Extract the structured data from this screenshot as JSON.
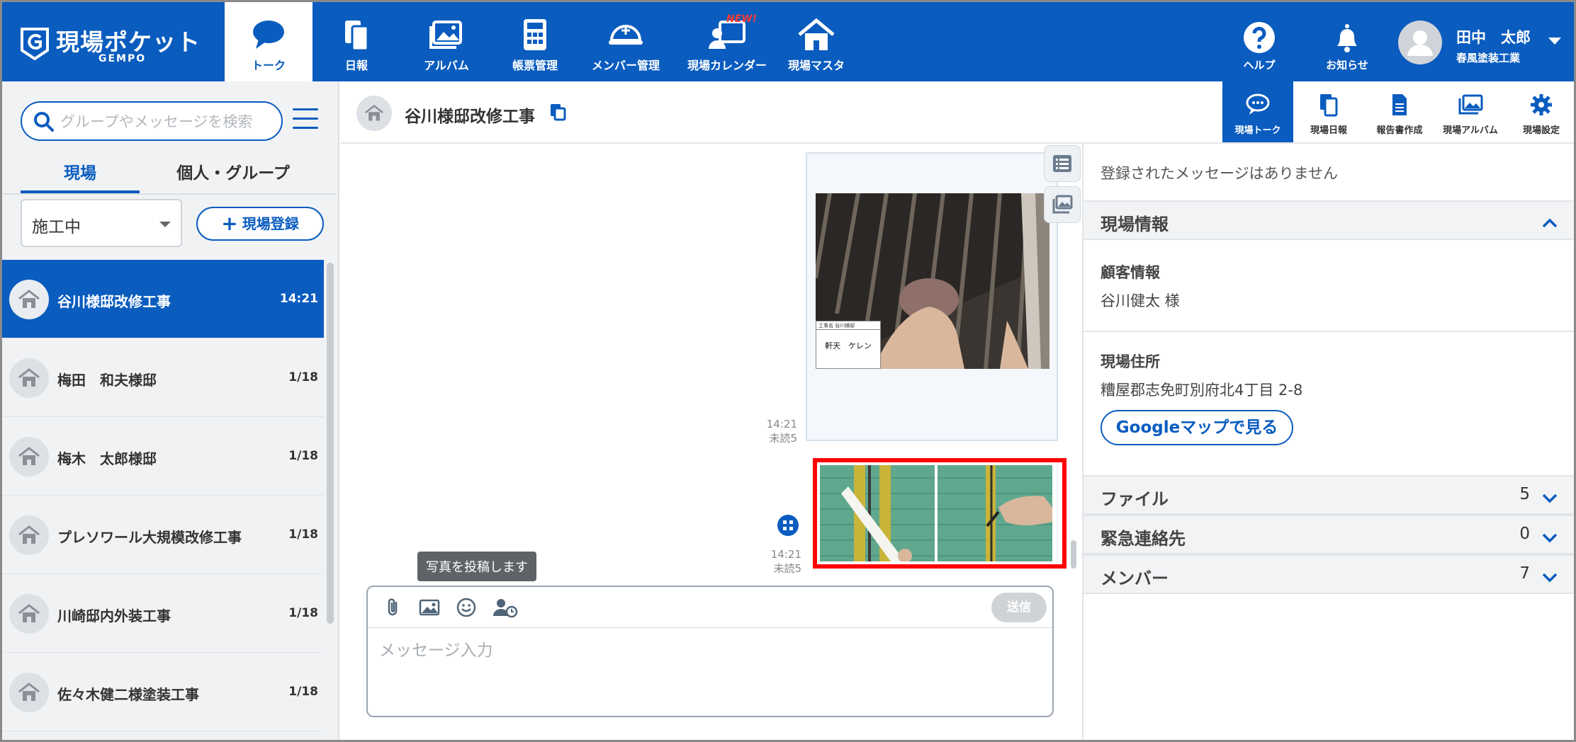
{
  "app": {
    "logo_title": "現場ポケット",
    "logo_sub": "GEMPO"
  },
  "nav": {
    "items": [
      {
        "label": "トーク",
        "icon": "chat-icon",
        "active": true
      },
      {
        "label": "日報",
        "icon": "daily-report-icon"
      },
      {
        "label": "アルバム",
        "icon": "album-icon"
      },
      {
        "label": "帳票管理",
        "icon": "calculator-icon"
      },
      {
        "label": "メンバー管理",
        "icon": "helmet-icon"
      },
      {
        "label": "現場カレンダー",
        "icon": "calendar-person-icon",
        "badge": "NEW!"
      },
      {
        "label": "現場マスタ",
        "icon": "house-icon"
      }
    ],
    "help_label": "ヘルプ",
    "notify_label": "お知らせ",
    "user_name": "田中　太郎",
    "user_company": "春風塗装工業"
  },
  "sidebar": {
    "search_placeholder": "グループやメッセージを検索",
    "tabs": [
      "現場",
      "個人・グループ"
    ],
    "status_value": "施工中",
    "add_site_label": "現場登録",
    "sites": [
      {
        "name": "谷川様邸改修工事",
        "date": "14:21",
        "selected": true
      },
      {
        "name": "梅田　和夫様邸",
        "date": "1/18"
      },
      {
        "name": "梅木　太郎様邸",
        "date": "1/18"
      },
      {
        "name": "プレソワール大規模改修工事",
        "date": "1/18"
      },
      {
        "name": "川崎邸内外装工事",
        "date": "1/18"
      },
      {
        "name": "佐々木健二様塗装工事",
        "date": "1/18"
      }
    ]
  },
  "chat_header": {
    "title": "谷川様邸改修工事",
    "tools": [
      {
        "label": "現場トーク",
        "icon": "chat-icon",
        "active": true
      },
      {
        "label": "現場日報",
        "icon": "daily-report-icon"
      },
      {
        "label": "報告書作成",
        "icon": "document-icon"
      },
      {
        "label": "現場アルバム",
        "icon": "album-icon"
      },
      {
        "label": "現場設定",
        "icon": "gear-icon"
      }
    ]
  },
  "chat": {
    "messages": [
      {
        "time": "14:21",
        "read": "未読5",
        "photo_caption": "軒天　ケレン",
        "photo_header": "工事名 谷川様邸"
      },
      {
        "time": "14:21",
        "read": "未読5"
      }
    ],
    "tooltip": "写真を投稿します",
    "send_label": "送信",
    "input_placeholder": "メッセージ入力"
  },
  "right_panel": {
    "no_messages": "登録されたメッセージはありません",
    "site_info_label": "現場情報",
    "customer_label": "顧客情報",
    "customer_value": "谷川健太 様",
    "address_label": "現場住所",
    "address_value": "糟屋郡志免町別府北4丁目 2-8",
    "maps_label": "Googleマップで見る",
    "sections": [
      {
        "label": "ファイル",
        "count": "5"
      },
      {
        "label": "緊急連絡先",
        "count": "0"
      },
      {
        "label": "メンバー",
        "count": "7"
      }
    ]
  },
  "colors": {
    "brand": "#0a5cbf",
    "highlight": "#ff0000"
  }
}
